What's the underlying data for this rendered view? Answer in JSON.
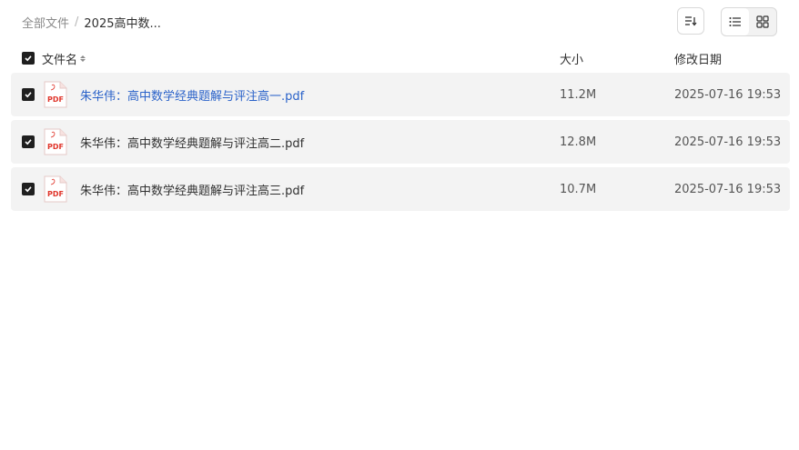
{
  "breadcrumb": {
    "root": "全部文件",
    "separator": "/",
    "current": "2025高中数..."
  },
  "toolbar": {
    "sort_icon": "sort-icon",
    "list_view_icon": "list-view-icon",
    "grid_view_icon": "grid-view-icon",
    "active_view": "list"
  },
  "table": {
    "headers": {
      "name": "文件名",
      "size": "大小",
      "modified": "修改日期"
    },
    "select_all_checked": true,
    "rows": [
      {
        "name": "朱华伟：高中数学经典题解与评注高一.pdf",
        "size": "11.2M",
        "modified": "2025-07-16 19:53",
        "checked": true,
        "highlighted": true
      },
      {
        "name": "朱华伟：高中数学经典题解与评注高二.pdf",
        "size": "12.8M",
        "modified": "2025-07-16 19:53",
        "checked": true,
        "highlighted": false
      },
      {
        "name": "朱华伟：高中数学经典题解与评注高三.pdf",
        "size": "10.7M",
        "modified": "2025-07-16 19:53",
        "checked": true,
        "highlighted": false
      }
    ],
    "file_icon_label": "PDF"
  },
  "colors": {
    "link_blue": "#2a62c9",
    "row_bg": "#f3f3f3",
    "pdf_red": "#e0352b"
  }
}
